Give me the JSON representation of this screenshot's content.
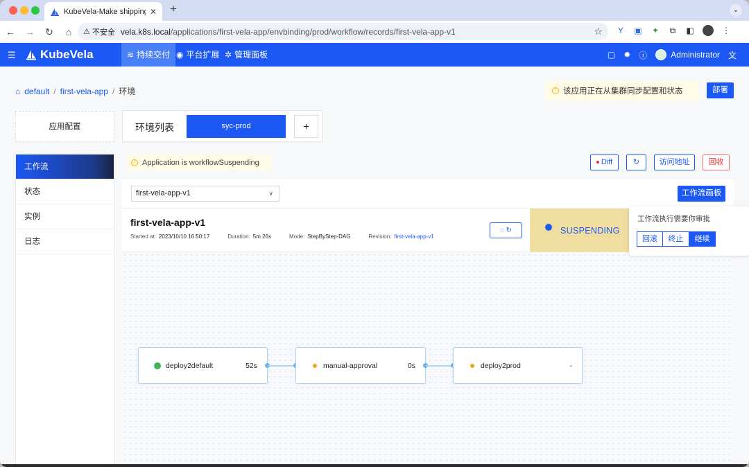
{
  "browser": {
    "tab_title": "KubeVela-Make shipping app",
    "insecure_label": "不安全",
    "url_host": "vela.k8s.local",
    "url_path": "/applications/first-vela-app/envbinding/prod/workflow/records/first-vela-app-v1"
  },
  "header": {
    "brand": "KubeVela",
    "nav": [
      {
        "label": "持续交付"
      },
      {
        "label": "平台扩展"
      },
      {
        "label": "管理面板"
      }
    ],
    "user": "Administrator"
  },
  "breadcrumb": {
    "items": [
      "default",
      "first-vela-app",
      "环境"
    ]
  },
  "sync_tip": "该应用正在从集群同步配置和状态",
  "deploy_label": "部署",
  "app_config_label": "应用配置",
  "env": {
    "label": "环境列表",
    "active": "syc-prod",
    "add": "+"
  },
  "sidenav": [
    "工作流",
    "状态",
    "实例",
    "日志"
  ],
  "app_tip": "Application is workflowSuspending",
  "actions": {
    "diff": "Diff",
    "access": "访问地址",
    "recycle": "回收"
  },
  "workflow": {
    "record_selected": "first-vela-app-v1",
    "board_label": "工作流画板",
    "title": "first-vela-app-v1",
    "started_label": "Started at:",
    "started_value": "2023/10/10 16:50:17",
    "duration_label": "Duration:",
    "duration_value": "5m 26s",
    "mode_label": "Mode:",
    "mode_value": "StepByStep-DAG",
    "revision_label": "Revision:",
    "revision_value": "first-vela-app-v1",
    "status": "SUSPENDING",
    "steps": [
      {
        "name": "deploy2default",
        "time": "52s",
        "state": "succeeded"
      },
      {
        "name": "manual-approval",
        "time": "0s",
        "state": "pending"
      },
      {
        "name": "deploy2prod",
        "time": "-",
        "state": "pending"
      }
    ]
  },
  "approval": {
    "message": "工作流执行需要你审批",
    "rollback": "回滚",
    "terminate": "终止",
    "resume": "继续"
  },
  "colors": {
    "primary": "#1b58f4",
    "status_bg": "#f0dea0",
    "success": "#3fb651",
    "pending": "#e6a52e"
  }
}
